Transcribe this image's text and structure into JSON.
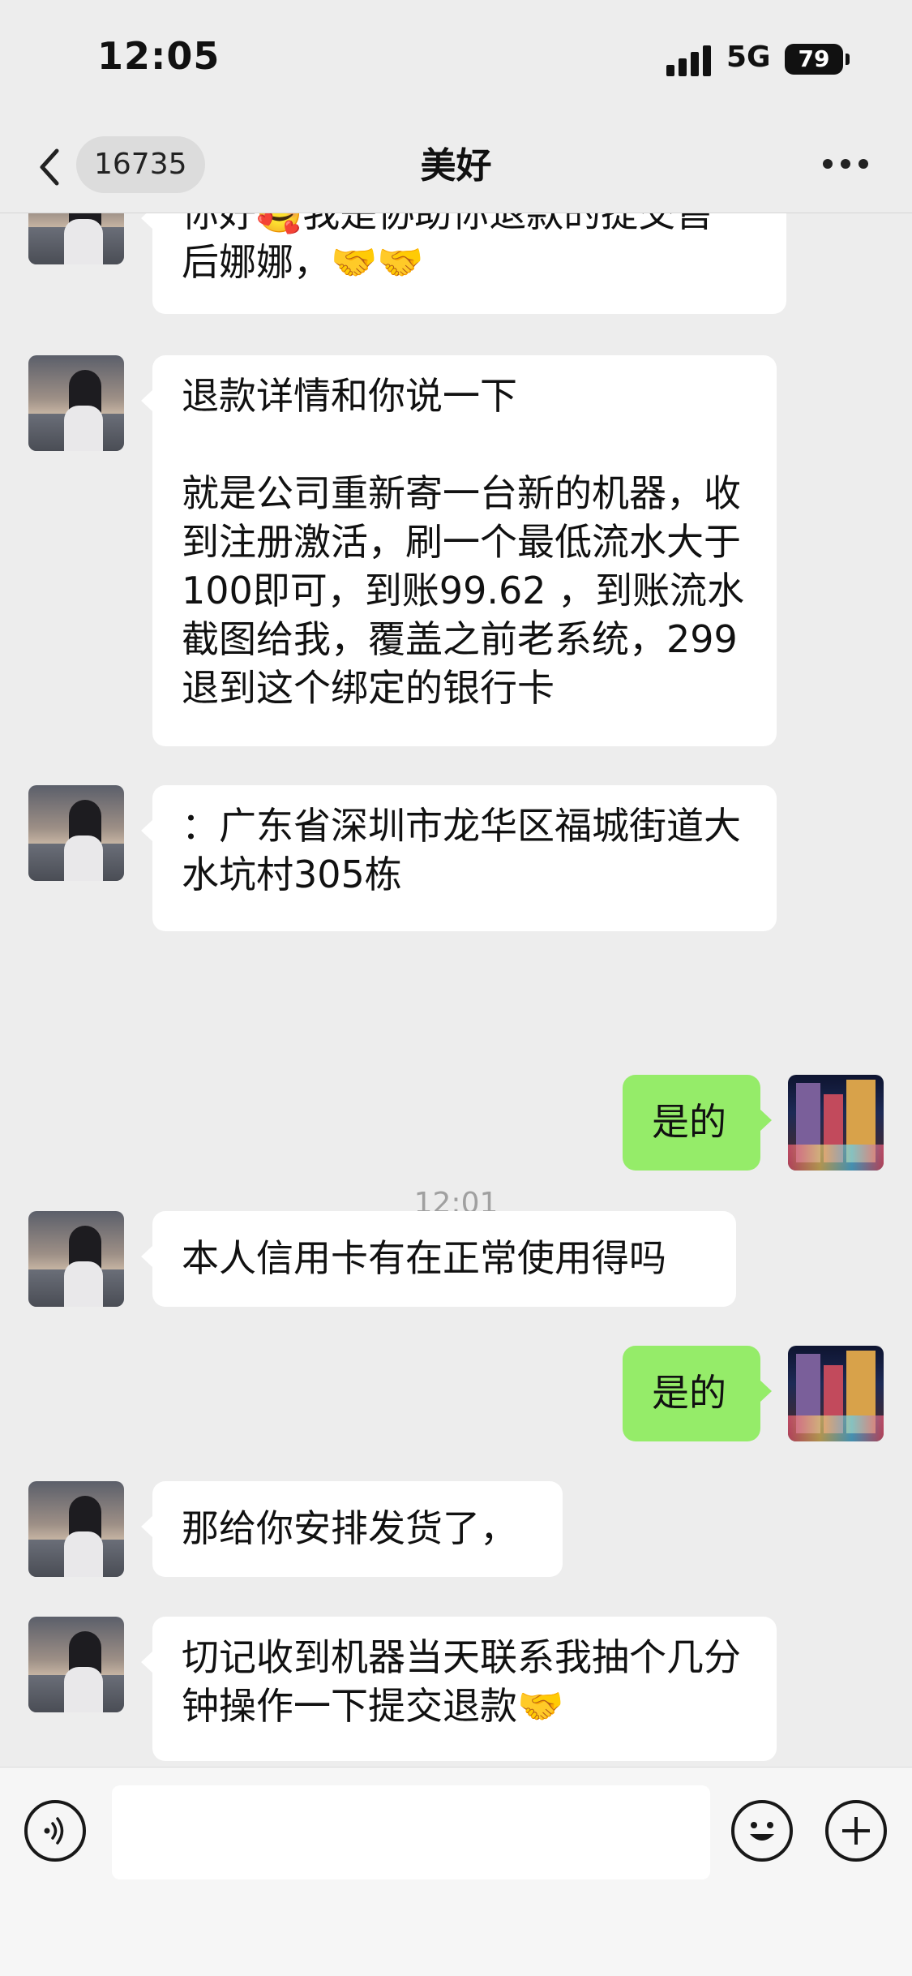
{
  "status_bar": {
    "time": "12:05",
    "network": "5G",
    "battery": "79"
  },
  "nav": {
    "badge_count": "16735",
    "title": "美好",
    "back_icon": "chevron-left-icon",
    "more_icon": "ellipsis-icon"
  },
  "messages": [
    {
      "side": "left",
      "text": "你好🥰我是协助你退款的提交售\n后娜娜，🤝🤝"
    },
    {
      "side": "left",
      "text": "退款详情和你说一下\n\n就是公司重新寄一台新的机器，收到注册激活，刷一个最低流水大于100即可，到账99.62 ，到账流水截图给我，覆盖之前老系统，299退到这个绑定的银行卡"
    },
    {
      "side": "left",
      "text": "：广东省深圳市龙华区福城街道大水坑村305栋"
    },
    {
      "side": "right",
      "text": "是的"
    },
    {
      "side": "left",
      "text": "本人信用卡有在正常使用得吗"
    },
    {
      "side": "right",
      "text": "是的"
    },
    {
      "side": "left",
      "text": "那给你安排发货了，"
    },
    {
      "side": "left",
      "text": "切记收到机器当天联系我抽个几分钟操作一下提交退款🤝"
    }
  ],
  "timestamp": "12:01",
  "input_bar": {
    "voice_icon": "voice-icon",
    "emoji_icon": "emoji-icon",
    "plus_icon": "plus-icon",
    "text_value": ""
  },
  "colors": {
    "background": "#ededed",
    "bubble_left": "#ffffff",
    "bubble_right": "#95ec69"
  }
}
